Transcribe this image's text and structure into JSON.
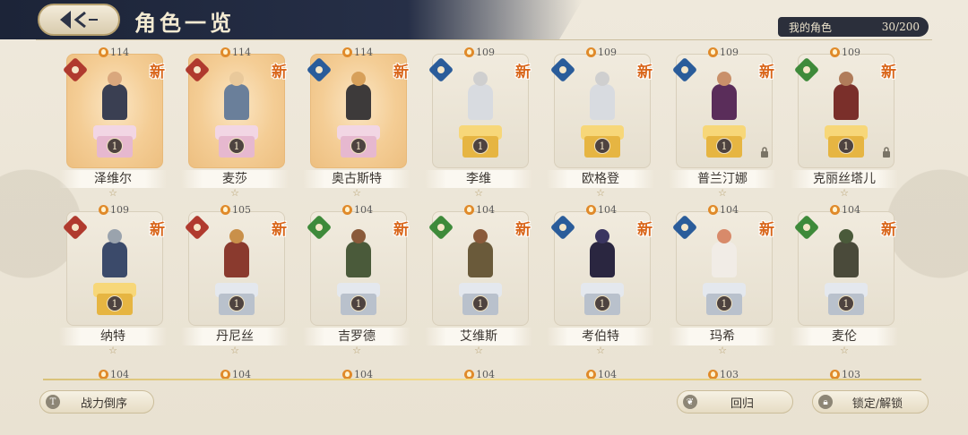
{
  "header": {
    "title": "角色一览",
    "count_label": "我的角色",
    "count_value": "30/200"
  },
  "cards": [
    {
      "name": "泽维尔",
      "power": "114",
      "class": "red",
      "new": "新",
      "level": "1",
      "pedestal": "pink",
      "glow": true,
      "locked": false,
      "hero_color": "#3a3f52",
      "head_color": "#d9a77d"
    },
    {
      "name": "麦莎",
      "power": "114",
      "class": "red",
      "new": "新",
      "level": "1",
      "pedestal": "pink",
      "glow": true,
      "locked": false,
      "hero_color": "#6a7f9a",
      "head_color": "#e9c99b"
    },
    {
      "name": "奥古斯特",
      "power": "114",
      "class": "blue",
      "new": "新",
      "level": "1",
      "pedestal": "pink",
      "glow": true,
      "locked": false,
      "hero_color": "#3d3a3a",
      "head_color": "#d7a05a"
    },
    {
      "name": "李维",
      "power": "109",
      "class": "blue",
      "new": "新",
      "level": "1",
      "pedestal": "gold",
      "glow": false,
      "locked": false,
      "hero_color": "#d8dbe0",
      "head_color": "#cfcfcf"
    },
    {
      "name": "欧格登",
      "power": "109",
      "class": "blue",
      "new": "新",
      "level": "1",
      "pedestal": "gold",
      "glow": false,
      "locked": false,
      "hero_color": "#d8dbe0",
      "head_color": "#cfcfcf"
    },
    {
      "name": "普兰汀娜",
      "power": "109",
      "class": "blue",
      "new": "新",
      "level": "1",
      "pedestal": "gold",
      "glow": false,
      "locked": true,
      "hero_color": "#5a2d5a",
      "head_color": "#c9906a"
    },
    {
      "name": "克丽丝塔儿",
      "power": "109",
      "class": "green",
      "new": "新",
      "level": "1",
      "pedestal": "gold",
      "glow": false,
      "locked": true,
      "hero_color": "#7a2f2a",
      "head_color": "#b07c5a"
    },
    {
      "name": "纳特",
      "power": "109",
      "class": "red",
      "new": "新",
      "level": "1",
      "pedestal": "gold",
      "glow": false,
      "locked": false,
      "hero_color": "#3b4a6a",
      "head_color": "#9aa3ad"
    },
    {
      "name": "丹尼丝",
      "power": "105",
      "class": "red",
      "new": "新",
      "level": "1",
      "pedestal": "silver",
      "glow": false,
      "locked": false,
      "hero_color": "#8a3a2e",
      "head_color": "#c9904a"
    },
    {
      "name": "吉罗德",
      "power": "104",
      "class": "green",
      "new": "新",
      "level": "1",
      "pedestal": "silver",
      "glow": false,
      "locked": false,
      "hero_color": "#4a5a3a",
      "head_color": "#8a5a3a"
    },
    {
      "name": "艾维斯",
      "power": "104",
      "class": "green",
      "new": "新",
      "level": "1",
      "pedestal": "silver",
      "glow": false,
      "locked": false,
      "hero_color": "#6a5a3a",
      "head_color": "#8a5a3a"
    },
    {
      "name": "考伯特",
      "power": "104",
      "class": "blue",
      "new": "新",
      "level": "1",
      "pedestal": "silver",
      "glow": false,
      "locked": false,
      "hero_color": "#2a2640",
      "head_color": "#3a3560"
    },
    {
      "name": "玛希",
      "power": "104",
      "class": "blue",
      "new": "新",
      "level": "1",
      "pedestal": "silver",
      "glow": false,
      "locked": false,
      "hero_color": "#f1ece6",
      "head_color": "#d88a6a"
    },
    {
      "name": "麦伦",
      "power": "104",
      "class": "green",
      "new": "新",
      "level": "1",
      "pedestal": "silver",
      "glow": false,
      "locked": false,
      "hero_color": "#4a4a3a",
      "head_color": "#4a5a3a"
    }
  ],
  "partial_row_powers": [
    "104",
    "104",
    "104",
    "104",
    "104",
    "103",
    "103"
  ],
  "star_glyph": "☆",
  "buttons": {
    "sort": {
      "label": "战力倒序",
      "icon_text": "T"
    },
    "return": {
      "label": "回归"
    },
    "lock": {
      "label": "锁定/解锁"
    }
  },
  "colors": {
    "header_bg": "#1c2438",
    "new_tag": "#d9661b",
    "accent_gold": "#d9c27a"
  }
}
